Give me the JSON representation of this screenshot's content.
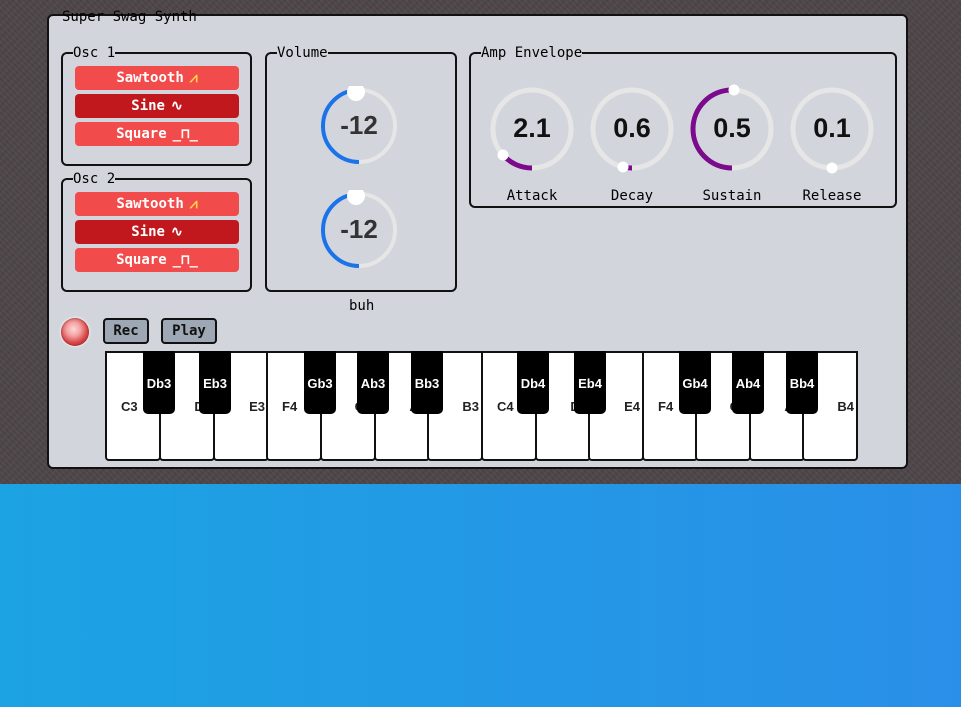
{
  "synth": {
    "title": "Super Swag Synth"
  },
  "osc1": {
    "title": "Osc 1",
    "buttons": [
      {
        "label": "Sawtooth",
        "glyph": "⩘",
        "active": false
      },
      {
        "label": "Sine",
        "glyph": "∿",
        "active": true
      },
      {
        "label": "Square",
        "glyph": "_⊓_",
        "active": false
      }
    ]
  },
  "osc2": {
    "title": "Osc 2",
    "buttons": [
      {
        "label": "Sawtooth",
        "glyph": "⩘",
        "active": false
      },
      {
        "label": "Sine",
        "glyph": "∿",
        "active": true
      },
      {
        "label": "Square",
        "glyph": "_⊓_",
        "active": false
      }
    ]
  },
  "volume": {
    "title": "Volume",
    "knobs": [
      {
        "value": "-12"
      },
      {
        "value": "-12"
      }
    ],
    "caption": "buh",
    "accent": "#1a73e8"
  },
  "envelope": {
    "title": "Amp Envelope",
    "accent": "#7b0a8c",
    "knobs": [
      {
        "label": "Attack",
        "value": "2.1"
      },
      {
        "label": "Decay",
        "value": "0.6"
      },
      {
        "label": "Sustain",
        "value": "0.5"
      },
      {
        "label": "Release",
        "value": "0.1"
      }
    ]
  },
  "transport": {
    "rec": "Rec",
    "play": "Play"
  },
  "keyboard": {
    "white": [
      "C3",
      "D3",
      "E3",
      "F4",
      "G3",
      "A3",
      "B3",
      "C4",
      "D4",
      "E4",
      "F4",
      "G4",
      "A4",
      "B4"
    ],
    "black": [
      "Db3",
      "Eb3",
      "Gb3",
      "Ab3",
      "Bb3",
      "Db4",
      "Eb4",
      "Gb4",
      "Ab4",
      "Bb4"
    ]
  }
}
